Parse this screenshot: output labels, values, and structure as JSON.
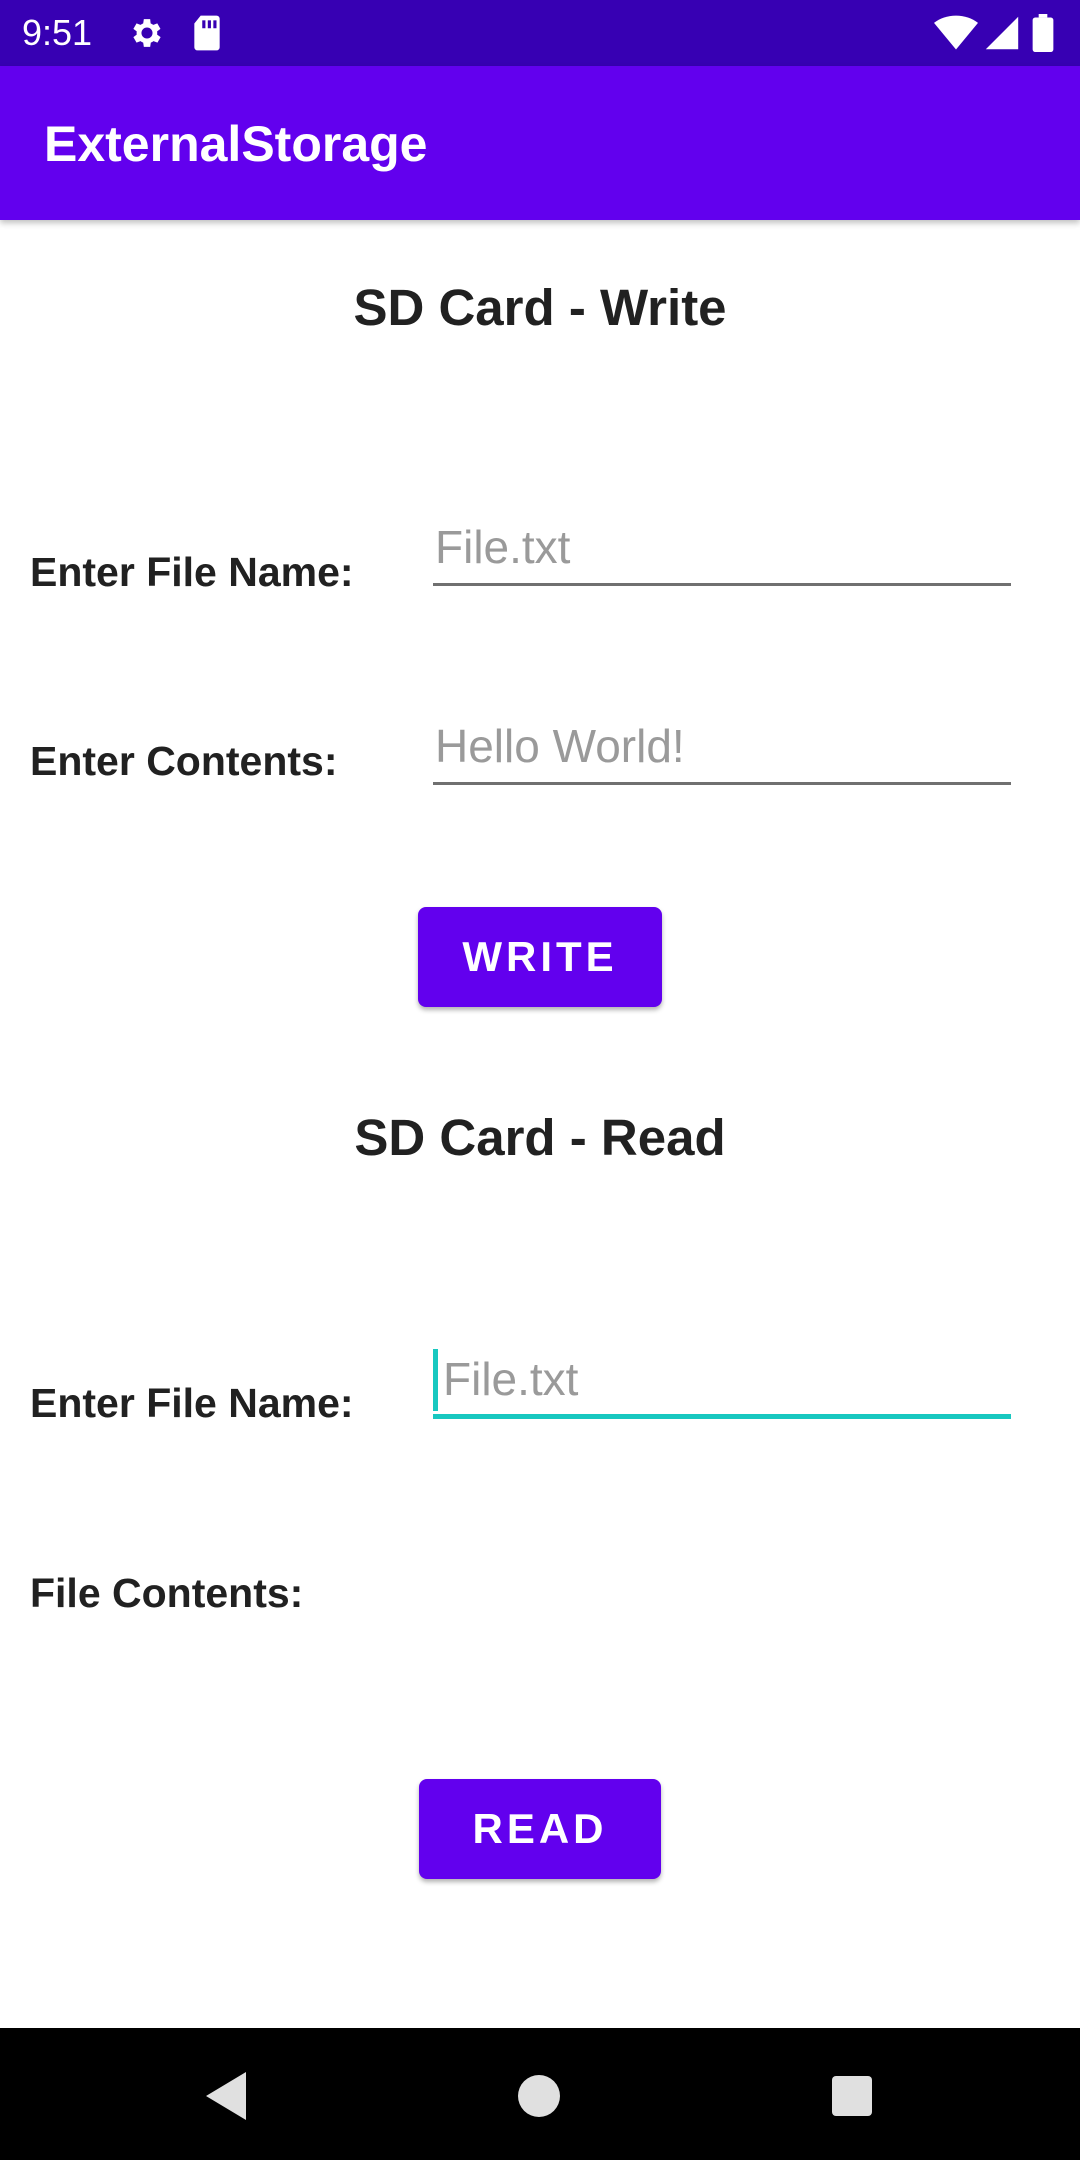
{
  "status_bar": {
    "time": "9:51",
    "left_icons": [
      "gear-icon",
      "sd-card-icon"
    ],
    "right_icons": [
      "wifi-icon",
      "signal-icon",
      "battery-icon"
    ],
    "background": "#3700B3"
  },
  "app_bar": {
    "title": "ExternalStorage",
    "background": "#6200EE"
  },
  "write_section": {
    "title": "SD Card - Write",
    "file_name_label": "Enter File Name:",
    "file_name_placeholder": "File.txt",
    "contents_label": "Enter Contents:",
    "contents_placeholder": "Hello World!",
    "button_label": "WRITE"
  },
  "read_section": {
    "title": "SD Card - Read",
    "file_name_label": "Enter File Name:",
    "file_name_placeholder": "File.txt",
    "contents_label": "File Contents:",
    "button_label": "READ"
  },
  "nav_bar": {
    "buttons": [
      "back-icon",
      "home-icon",
      "recents-icon"
    ]
  },
  "colors": {
    "accent": "#6200EE",
    "focus": "#18C8C0"
  }
}
